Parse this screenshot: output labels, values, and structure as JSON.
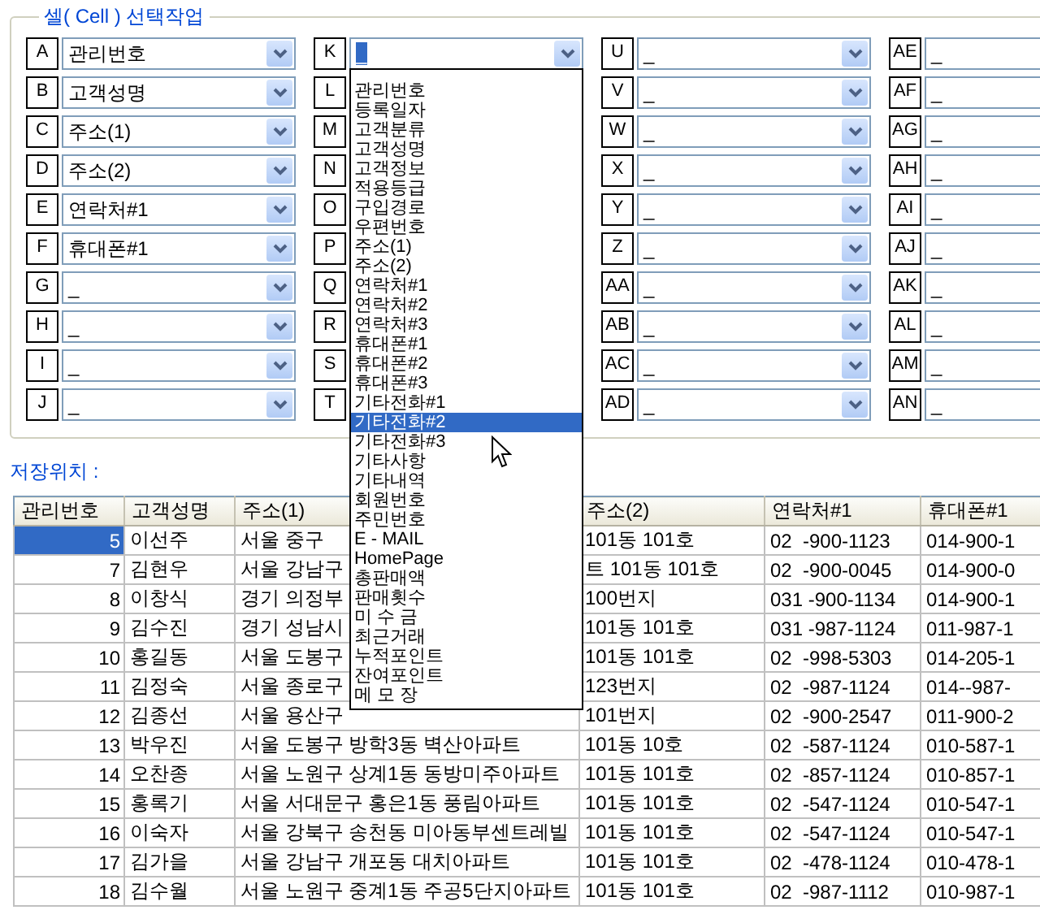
{
  "cell_selection": {
    "title": "셀( Cell ) 선택작업",
    "cells": [
      {
        "cell": "A",
        "value": "관리번호",
        "expanded": false
      },
      {
        "cell": "B",
        "value": "고객성명",
        "expanded": false
      },
      {
        "cell": "C",
        "value": "주소(1)",
        "expanded": false
      },
      {
        "cell": "D",
        "value": "주소(2)",
        "expanded": false
      },
      {
        "cell": "E",
        "value": "연락처#1",
        "expanded": false
      },
      {
        "cell": "F",
        "value": "휴대폰#1",
        "expanded": false
      },
      {
        "cell": "G",
        "value": "_",
        "expanded": false
      },
      {
        "cell": "H",
        "value": "_",
        "expanded": false
      },
      {
        "cell": "I",
        "value": "_",
        "expanded": false
      },
      {
        "cell": "J",
        "value": "_",
        "expanded": false
      },
      {
        "cell": "K",
        "value": "_",
        "expanded": true
      },
      {
        "cell": "L",
        "expanded": false
      },
      {
        "cell": "M",
        "expanded": false
      },
      {
        "cell": "N",
        "expanded": false
      },
      {
        "cell": "O",
        "expanded": false
      },
      {
        "cell": "P",
        "expanded": false
      },
      {
        "cell": "Q",
        "expanded": false
      },
      {
        "cell": "R",
        "expanded": false
      },
      {
        "cell": "S",
        "expanded": false
      },
      {
        "cell": "T",
        "expanded": false
      },
      {
        "cell": "U",
        "value": "_",
        "expanded": false
      },
      {
        "cell": "V",
        "value": "_",
        "expanded": false
      },
      {
        "cell": "W",
        "value": "_",
        "expanded": false
      },
      {
        "cell": "X",
        "value": "_",
        "expanded": false
      },
      {
        "cell": "Y",
        "value": "_",
        "expanded": false
      },
      {
        "cell": "Z",
        "value": "_",
        "expanded": false
      },
      {
        "cell": "AA",
        "value": "_",
        "expanded": false
      },
      {
        "cell": "AB",
        "value": "_",
        "expanded": false
      },
      {
        "cell": "AC",
        "value": "_",
        "expanded": false
      },
      {
        "cell": "AD",
        "value": "_",
        "expanded": false
      },
      {
        "cell": "AE",
        "value": "_",
        "expanded": false
      },
      {
        "cell": "AF",
        "value": "_",
        "expanded": false
      },
      {
        "cell": "AG",
        "value": "_",
        "expanded": false
      },
      {
        "cell": "AH",
        "value": "_",
        "expanded": false
      },
      {
        "cell": "AI",
        "value": "_",
        "expanded": false
      },
      {
        "cell": "AJ",
        "value": "_",
        "expanded": false
      },
      {
        "cell": "AK",
        "value": "_",
        "expanded": false
      },
      {
        "cell": "AL",
        "value": "_",
        "expanded": false
      },
      {
        "cell": "AM",
        "value": "_",
        "expanded": false
      },
      {
        "cell": "AN",
        "value": "_",
        "expanded": false
      }
    ],
    "dropdown_options": [
      {
        "label": "관리번호",
        "selected": false
      },
      {
        "label": "등록일자",
        "selected": false
      },
      {
        "label": "고객분류",
        "selected": false
      },
      {
        "label": "고객성명",
        "selected": false
      },
      {
        "label": "고객정보",
        "selected": false
      },
      {
        "label": "적용등급",
        "selected": false
      },
      {
        "label": "구입경로",
        "selected": false
      },
      {
        "label": "우편번호",
        "selected": false
      },
      {
        "label": "주소(1)",
        "selected": false
      },
      {
        "label": "주소(2)",
        "selected": false
      },
      {
        "label": "연락처#1",
        "selected": false
      },
      {
        "label": "연락처#2",
        "selected": false
      },
      {
        "label": "연락처#3",
        "selected": false
      },
      {
        "label": "휴대폰#1",
        "selected": false
      },
      {
        "label": "휴대폰#2",
        "selected": false
      },
      {
        "label": "휴대폰#3",
        "selected": false
      },
      {
        "label": "기타전화#1",
        "selected": false
      },
      {
        "label": "기타전화#2",
        "selected": true
      },
      {
        "label": "기타전화#3",
        "selected": false
      },
      {
        "label": "기타사항",
        "selected": false
      },
      {
        "label": "기타내역",
        "selected": false
      },
      {
        "label": "회원번호",
        "selected": false
      },
      {
        "label": "주민번호",
        "selected": false
      },
      {
        "label": "E - MAIL",
        "selected": false
      },
      {
        "label": "HomePage",
        "selected": false
      },
      {
        "label": "총판매액",
        "selected": false
      },
      {
        "label": "판매횟수",
        "selected": false
      },
      {
        "label": "미 수 금",
        "selected": false
      },
      {
        "label": "최근거래",
        "selected": false
      },
      {
        "label": "누적포인트",
        "selected": false
      },
      {
        "label": "잔여포인트",
        "selected": false
      },
      {
        "label": "메 모 장",
        "selected": false
      }
    ]
  },
  "storage_label": "저장위치 :",
  "table": {
    "columns": [
      "관리번호",
      "고객성명",
      "주소(1)",
      "주소(2)",
      "연락처#1",
      "휴대폰#1"
    ],
    "rows": [
      {
        "id": "5",
        "name": "이선주",
        "address_1": "서울 중구",
        "address_2": "101동 101호",
        "phone_1": "02  -900-1123",
        "mobile_1": "014-900-1",
        "selected": true
      },
      {
        "id": "7",
        "name": "김현우",
        "address_1": "서울 강남구",
        "address_2": "트 101동 101호",
        "phone_1": "02  -900-0045",
        "mobile_1": "014-900-0",
        "selected": false
      },
      {
        "id": "8",
        "name": "이창식",
        "address_1": "경기 의정부",
        "address_2": "100번지",
        "phone_1": "031 -900-1134",
        "mobile_1": "014-900-1",
        "selected": false
      },
      {
        "id": "9",
        "name": "김수진",
        "address_1": "경기 성남시",
        "address_2": "101동 101호",
        "phone_1": "031 -987-1124",
        "mobile_1": "011-987-1",
        "selected": false
      },
      {
        "id": "10",
        "name": "홍길동",
        "address_1": "서울 도봉구",
        "address_2": "101동 101호",
        "phone_1": "02  -998-5303",
        "mobile_1": "014-205-1",
        "selected": false
      },
      {
        "id": "11",
        "name": "김정숙",
        "address_1": "서울 종로구",
        "address_2": "123번지",
        "phone_1": "02  -987-1124",
        "mobile_1": "014--987-",
        "selected": false
      },
      {
        "id": "12",
        "name": "김종선",
        "address_1": "서울 용산구",
        "address_2": "101번지",
        "phone_1": "02  -900-2547",
        "mobile_1": "011-900-2",
        "selected": false
      },
      {
        "id": "13",
        "name": "박우진",
        "address_1": "서울 도봉구 방학3동 벽산아파트",
        "address_2": "101동 10호",
        "phone_1": "02  -587-1124",
        "mobile_1": "010-587-1",
        "selected": false
      },
      {
        "id": "14",
        "name": "오찬종",
        "address_1": "서울 노원구 상계1동 동방미주아파트",
        "address_2": "101동 101호",
        "phone_1": "02  -857-1124",
        "mobile_1": "010-857-1",
        "selected": false
      },
      {
        "id": "15",
        "name": "홍록기",
        "address_1": "서울 서대문구 홍은1동 풍림아파트",
        "address_2": "101동 101호",
        "phone_1": "02  -547-1124",
        "mobile_1": "010-547-1",
        "selected": false
      },
      {
        "id": "16",
        "name": "이숙자",
        "address_1": "서울 강북구 송천동 미아동부센트레빌",
        "address_2": "101동 101호",
        "phone_1": "02  -547-1124",
        "mobile_1": "010-547-1",
        "selected": false
      },
      {
        "id": "17",
        "name": "김가을",
        "address_1": "서울 강남구 개포동 대치아파트",
        "address_2": "101동 101호",
        "phone_1": "02  -478-1124",
        "mobile_1": "010-478-1",
        "selected": false
      },
      {
        "id": "18",
        "name": "김수월",
        "address_1": "서울 노원구 중계1동 주공5단지아파트",
        "address_2": "101동 101호",
        "phone_1": "02  -987-1112",
        "mobile_1": "010-987-1",
        "selected": false
      }
    ]
  }
}
